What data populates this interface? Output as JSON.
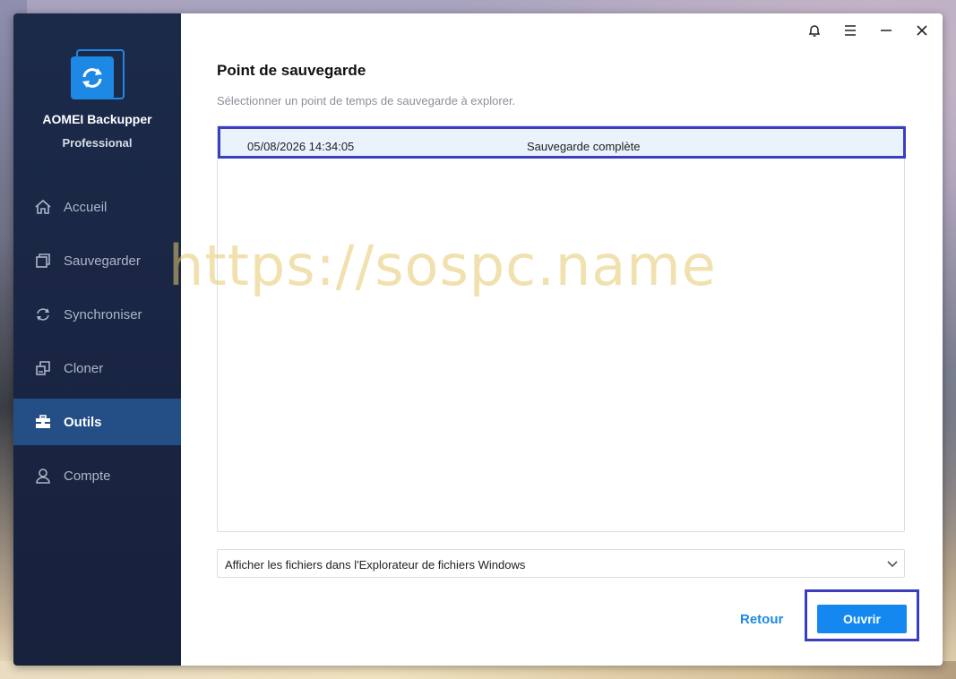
{
  "app": {
    "name": "AOMEI Backupper",
    "edition": "Professional"
  },
  "sidebar": {
    "items": [
      {
        "label": "Accueil",
        "icon": "home-icon",
        "active": false
      },
      {
        "label": "Sauvegarder",
        "icon": "backup-icon",
        "active": false
      },
      {
        "label": "Synchroniser",
        "icon": "sync-icon",
        "active": false
      },
      {
        "label": "Cloner",
        "icon": "clone-icon",
        "active": false
      },
      {
        "label": "Outils",
        "icon": "toolbox-icon",
        "active": true
      },
      {
        "label": "Compte",
        "icon": "user-icon",
        "active": false
      }
    ]
  },
  "titlebar": {
    "icons": [
      "bell-icon",
      "menu-icon",
      "minimize-icon",
      "close-icon"
    ]
  },
  "main": {
    "title": "Point de sauvegarde",
    "subtitle": "Sélectionner un point de temps de sauvegarde à explorer.",
    "backup_points": [
      {
        "time": "05/08/2026 14:34:05",
        "type": "Sauvegarde complète",
        "selected": true
      }
    ],
    "explore_option": {
      "selected": "Afficher les fichiers dans l'Explorateur de fichiers Windows"
    },
    "buttons": {
      "back": "Retour",
      "open": "Ouvrir"
    }
  },
  "watermark": "https://sospc.name",
  "colors": {
    "sidebar_bg": "#1c2a4a",
    "active_item": "#234e86",
    "accent": "#1488f0",
    "highlight_border": "#3b3fbf"
  }
}
